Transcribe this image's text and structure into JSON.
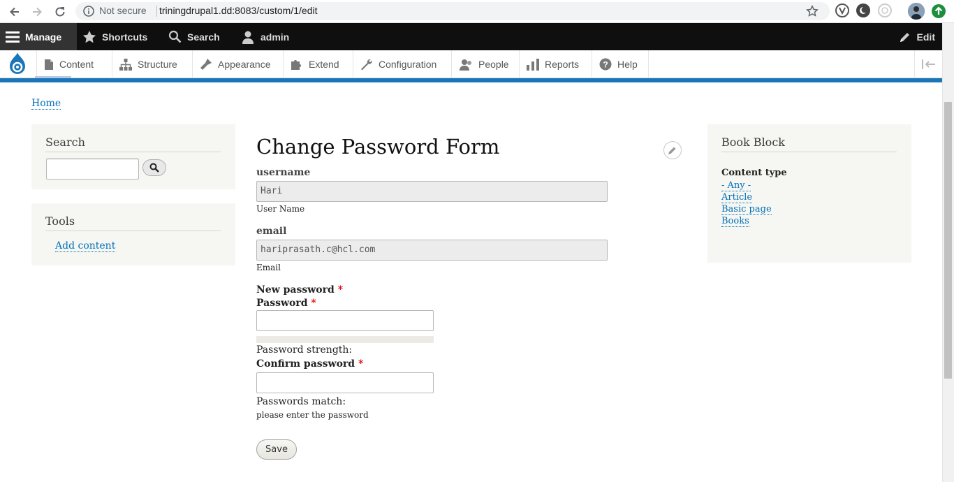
{
  "browser": {
    "security_label": "Not secure",
    "url": "triningdrupal1.dd:8083/custom/1/edit"
  },
  "toolbar": {
    "manage": "Manage",
    "shortcuts": "Shortcuts",
    "search": "Search",
    "user": "admin",
    "edit": "Edit"
  },
  "tray": {
    "items": [
      {
        "label": "Content",
        "icon": "file-icon"
      },
      {
        "label": "Structure",
        "icon": "sitemap-icon"
      },
      {
        "label": "Appearance",
        "icon": "paintbrush-icon"
      },
      {
        "label": "Extend",
        "icon": "puzzle-icon"
      },
      {
        "label": "Configuration",
        "icon": "wrench-icon"
      },
      {
        "label": "People",
        "icon": "people-icon"
      },
      {
        "label": "Reports",
        "icon": "bar-chart-icon"
      },
      {
        "label": "Help",
        "icon": "question-icon"
      }
    ]
  },
  "breadcrumb": {
    "home": "Home"
  },
  "sidebar": {
    "search_title": "Search",
    "tools_title": "Tools",
    "tools_link": "Add content"
  },
  "main": {
    "title": "Change Password Form",
    "username_label": "username",
    "username_value": "Hari",
    "username_desc": "User Name",
    "email_label": "email",
    "email_value": "hariprasath.c@hcl.com",
    "email_desc": "Email",
    "new_password_label": "New password",
    "password_label": "Password",
    "password_strength": "Password strength:",
    "confirm_label": "Confirm password",
    "passwords_match": "Passwords match:",
    "password_hint": "please enter the password",
    "save": "Save",
    "required_mark": "*"
  },
  "book_block": {
    "title": "Book Block",
    "content_type_label": "Content type",
    "options": [
      "- Any -",
      "Article",
      "Basic page",
      "Books"
    ]
  },
  "colors": {
    "toolbar_bg": "#0f0f0f",
    "accent_blue": "#1a76b8",
    "link": "#0071b8",
    "required": "#e00000"
  }
}
